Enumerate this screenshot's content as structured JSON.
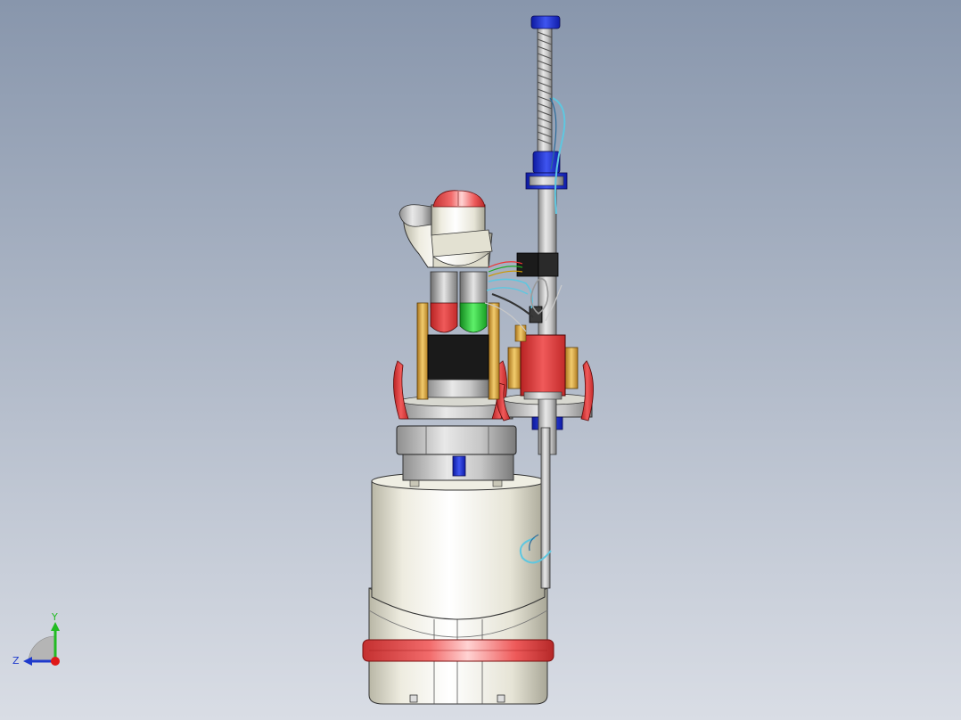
{
  "viewport": {
    "background_top": "#8896ac",
    "background_bottom": "#d9dde5"
  },
  "triad": {
    "y_label": "Y",
    "z_label": "Z",
    "y_color": "#22bb22",
    "z_color": "#1e3acc",
    "x_color": "#e01818"
  },
  "model": {
    "type": "3d-cad-assembly",
    "colors": {
      "body": "#e9e7d8",
      "accent_red": "#e74848",
      "accent_green": "#2bd23a",
      "accent_blue": "#1c2ccd",
      "bracket_gold": "#d6a640",
      "dark": "#222222",
      "cable_cyan": "#5ec7e0"
    }
  }
}
